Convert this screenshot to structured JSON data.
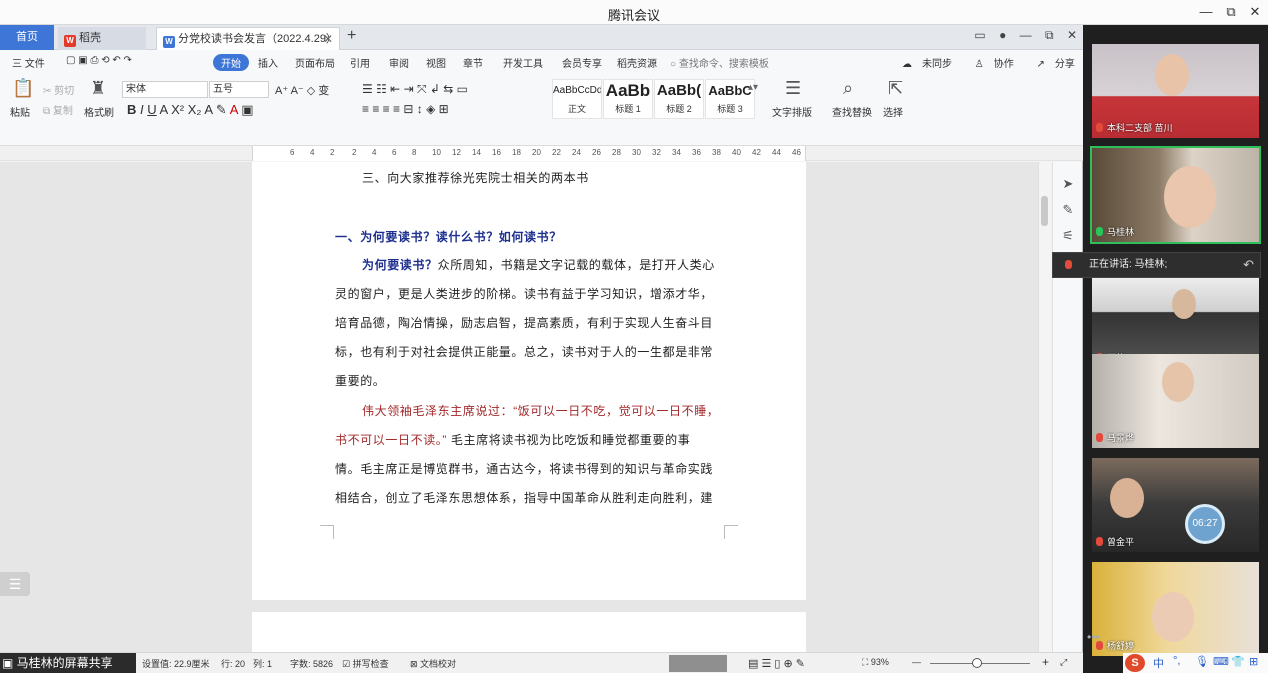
{
  "meeting": {
    "title": "腾讯会议",
    "minimize": "—",
    "restore": "⧉",
    "close": "✕"
  },
  "wps": {
    "tabs": {
      "home": "首页",
      "daoke": "稻壳",
      "doc": "分党校读书会发言（2022.4.29）",
      "doc_close": "✕",
      "add": "+"
    },
    "menu": {
      "file": "三 文件",
      "start": "开始",
      "items": [
        "插入",
        "页面布局",
        "引用",
        "审阅",
        "视图",
        "章节",
        "开发工具",
        "会员专享",
        "稻壳资源"
      ],
      "search": "查找命令、搜索模板",
      "unsynced": "未同步",
      "collab": "协作",
      "share": "分享"
    },
    "ribbon": {
      "paste": "粘贴",
      "cut": "剪切",
      "copy": "复制",
      "format_painter": "格式刷",
      "font_name": "宋体",
      "font_size": "五号",
      "styles": [
        {
          "sample": "AaBbCcDd",
          "name": "正文"
        },
        {
          "sample": "AaBb",
          "name": "标题 1"
        },
        {
          "sample": "AaBb(",
          "name": "标题 2"
        },
        {
          "sample": "AaBbC",
          "name": "标题 3"
        }
      ],
      "text_layout": "文字排版",
      "find_replace": "查找替换",
      "select": "选择"
    },
    "ruler_numbers": [
      "6",
      "4",
      "2",
      "2",
      "4",
      "6",
      "8",
      "10",
      "12",
      "14",
      "16",
      "18",
      "20",
      "22",
      "24",
      "26",
      "28",
      "30",
      "32",
      "34",
      "36",
      "38",
      "40",
      "42",
      "44",
      "46"
    ],
    "document": {
      "section": "三、向大家推荐徐光宪院士相关的两本书",
      "heading": "一、为何要读书？读什么书？如何读书？",
      "p1_lead": "为何要读书？",
      "p1_lines": [
        "众所周知，书籍是文字记载的载体，是打开人类心",
        "灵的窗户，更是人类进步的阶梯。读书有益于学习知识，增添才华，",
        "培育品德，陶冶情操，励志启智，提高素质，有利于实现人生奋斗目",
        "标，也有利于对社会提供正能量。总之，读书对于人的一生都是非常",
        "重要的。"
      ],
      "p2_red_1": "伟大领袖毛泽东主席说过：“饭可以一日不吃，觉可以一日不睡，",
      "p2_red_2": "书不可以一日不读。”",
      "p2_rest": " 毛主席将读书视为比吃饭和睡觉都重要的事",
      "p2_lines": [
        "情。毛主席正是博览群书，通古达今，将读书得到的知识与革命实践",
        "相结合，创立了毛泽东思想体系，指导中国革命从胜利走向胜利，建"
      ]
    },
    "status": {
      "share_label": "马桂林的屏幕共享",
      "position": "设置值: 22.9厘米",
      "row": "行: 20",
      "col": "列: 1",
      "word_count": "字数: 5826",
      "spell_check": "拼写检查",
      "doc_proof": "文档校对",
      "zoom": "93%",
      "zoom_minus": "—",
      "zoom_plus": "+"
    }
  },
  "participants": [
    {
      "name": "本科二支部 苗川",
      "mic": "muted"
    },
    {
      "name": "马桂林",
      "mic": "active"
    },
    {
      "name": "王佳",
      "mic": "muted"
    },
    {
      "name": "马景烨",
      "mic": "muted"
    },
    {
      "name": "曾金平",
      "mic": "muted"
    },
    {
      "name": "杨舒婷",
      "mic": "muted"
    }
  ],
  "speaking": "正在讲话: 马桂林;",
  "timer": "06:27",
  "ime": {
    "logo": "S",
    "lang": "中",
    "punct": "°,"
  },
  "colors": {
    "accent": "#3e76d8",
    "heading_blue": "#1e2f8f",
    "quote_red": "#a3282a",
    "speaking_green": "#2fbf5b"
  }
}
